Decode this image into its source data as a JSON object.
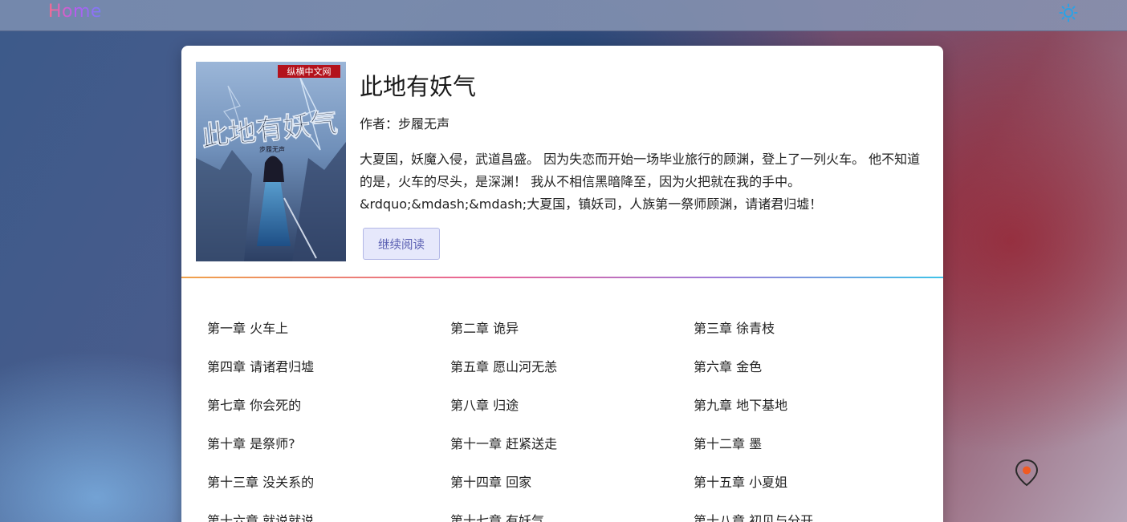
{
  "header": {
    "logo": "Home",
    "theme_icon": "sun-icon"
  },
  "book": {
    "title": "此地有妖气",
    "author": "作者：步履无声",
    "description": "大夏国，妖魔入侵，武道昌盛。 因为失恋而开始一场毕业旅行的顾渊，登上了一列火车。 他不知道的是，火车的尽头，是深渊！ 我从不相信黑暗降至，因为火把就在我的手中。&rdquo;&mdash;&mdash;大夏国，镇妖司，人族第一祭师顾渊，请诸君归墟！",
    "continue_label": "继续阅读",
    "cover": {
      "title_art": "此地有妖气",
      "site_badge": "纵横中文网",
      "author_small": "步履无声"
    }
  },
  "chapters": [
    "第一章 火车上",
    "第二章 诡异",
    "第三章 徐青枝",
    "第四章 请诸君归墟",
    "第五章 愿山河无恙",
    "第六章 金色",
    "第七章 你会死的",
    "第八章 归途",
    "第九章 地下基地",
    "第十章 是祭师?",
    "第十一章 赶紧送走",
    "第十二章 墨",
    "第十三章 没关系的",
    "第十四章 回家",
    "第十五章 小夏姐",
    "第十六章 就说就说",
    "第十七章 有妖气",
    "第十八章 初见与分开"
  ],
  "colors": {
    "accent": "#5a5fb2",
    "divider_start": "#f0a24a",
    "divider_end": "#3fc3e8",
    "sun": "#2aa2e6",
    "fab_dot": "#f05a22"
  },
  "fab_icon": "location-pin-icon"
}
